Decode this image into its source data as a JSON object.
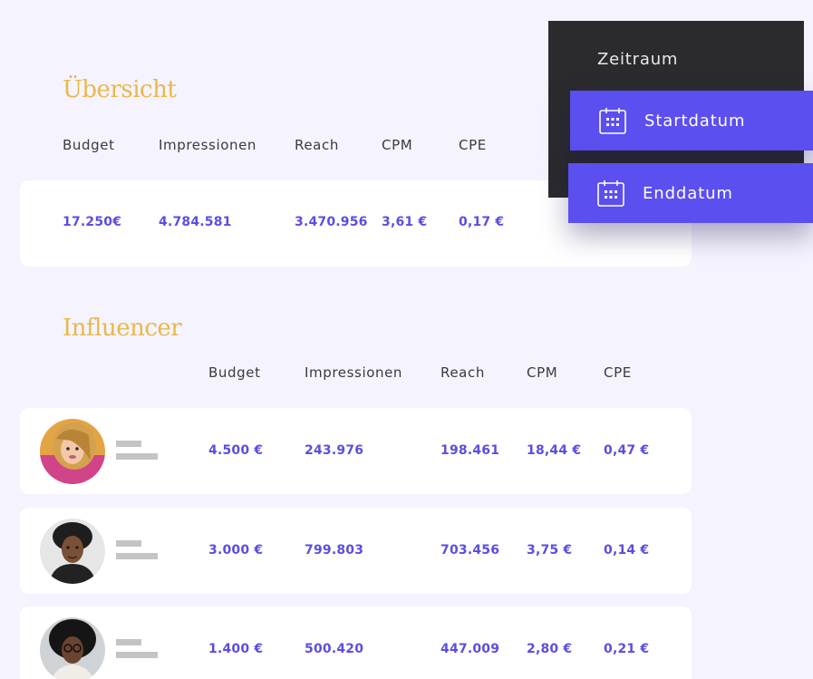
{
  "overview": {
    "title": "Übersicht",
    "headers": [
      "Budget",
      "Impressionen",
      "Reach",
      "CPM",
      "CPE"
    ],
    "values": {
      "budget": "17.250€",
      "impressions": "4.784.581",
      "reach": "3.470.956",
      "cpm": "3,61 €",
      "cpe": "0,17 €"
    }
  },
  "influencer": {
    "title": "Influencer",
    "headers": [
      "Budget",
      "Impressionen",
      "Reach",
      "CPM",
      "CPE"
    ],
    "rows": [
      {
        "budget": "4.500 €",
        "impressions": "243.976",
        "reach": "198.461",
        "cpm": "18,44 €",
        "cpe": "0,47 €"
      },
      {
        "budget": "3.000 €",
        "impressions": "799.803",
        "reach": "703.456",
        "cpm": "3,75 €",
        "cpe": "0,14 €"
      },
      {
        "budget": "1.400 €",
        "impressions": "500.420",
        "reach": "447.009",
        "cpm": "2,80 €",
        "cpe": "0,21 €"
      }
    ]
  },
  "dropdown": {
    "title": "Zeitraum",
    "start_label": "Startdatum",
    "end_label": "Enddatum",
    "icon": "calendar-icon",
    "accent": "#5b4ff0",
    "panel_color": "#2b2b2e"
  },
  "colors": {
    "background": "#f5f3fe",
    "heading": "#e8b84a",
    "value": "#5a4ee0"
  }
}
